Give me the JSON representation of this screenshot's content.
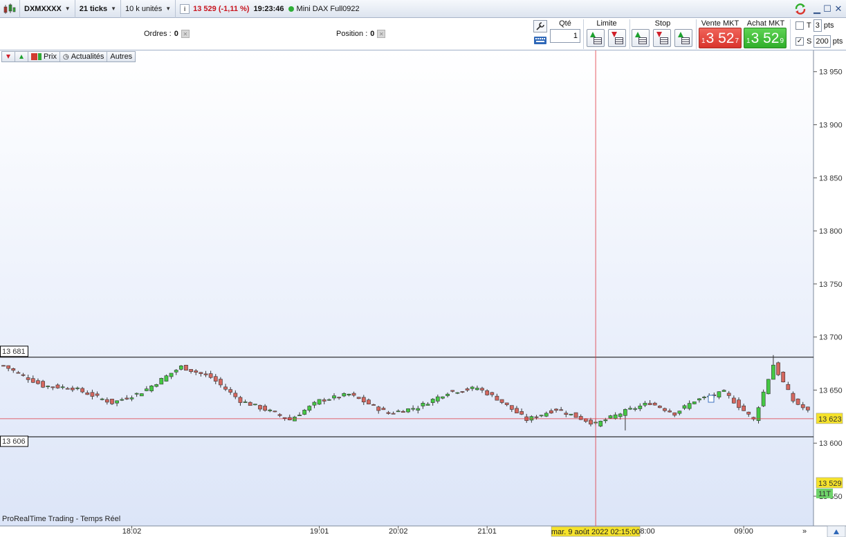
{
  "topbar": {
    "ticker": "DXMXXXX",
    "period": "21 ticks",
    "units": "10 k unités",
    "info_icon": "i",
    "price_change": "13 529 (-1,11 %)",
    "time": "19:23:46",
    "instrument": "Mini DAX Full0922"
  },
  "trading": {
    "orders_label": "Ordres :",
    "orders_value": "0",
    "position_label": "Position :",
    "position_value": "0",
    "qty_label": "Qté",
    "qty_value": "1",
    "limit_label": "Limite",
    "stop_label": "Stop",
    "sell_label": "Vente MKT",
    "buy_label": "Achat MKT",
    "sell_price": {
      "prefix": "1",
      "main": "3 52",
      "sup": "7"
    },
    "buy_price": {
      "prefix": "1",
      "main": "3 52",
      "sup": "9"
    },
    "t_label": "T",
    "t_value": "3",
    "t_unit": "pts",
    "s_label": "S",
    "s_value": "200",
    "s_unit": "pts",
    "s_checked": "✓"
  },
  "chart_toolbar": {
    "price_label": "Prix",
    "news_label": "Actualités",
    "other_label": "Autres"
  },
  "footer": {
    "label": "ProRealTime Trading - Temps Réel"
  },
  "chart_data": {
    "type": "candlestick",
    "y_ticks": [
      13550,
      13600,
      13650,
      13700,
      13750,
      13800,
      13850,
      13900,
      13950
    ],
    "ylim": [
      13522,
      13970
    ],
    "x_ticks": [
      {
        "label": "18:02",
        "index": 26
      },
      {
        "label": "19:01",
        "index": 64
      },
      {
        "label": "20:02",
        "index": 80
      },
      {
        "label": "21:01",
        "index": 98
      },
      {
        "label": "09:00",
        "index": 150
      }
    ],
    "partial_tick_label": "8:00",
    "crosshair": {
      "date_label": "mar. 9 août 2022 02:15:00",
      "index": 120,
      "price": 13623
    },
    "price_lines": [
      {
        "value": 13681,
        "label": "13 681"
      },
      {
        "value": 13606,
        "label": "13 606"
      }
    ],
    "badges": {
      "cursor": "13 623",
      "last": "13 529",
      "ticks": "11T"
    },
    "colors": {
      "up": "#44c844",
      "down": "#d4675f",
      "line": "#d94a4a",
      "crosshair": "#e0343c"
    },
    "candles_count": 164
  }
}
